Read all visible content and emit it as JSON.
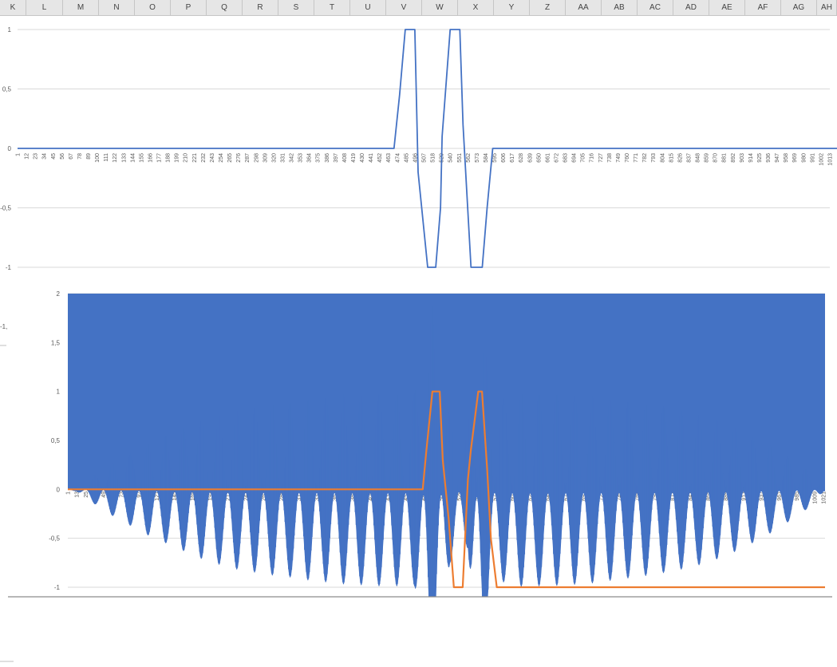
{
  "sheet": {
    "columns": [
      "K",
      "L",
      "M",
      "N",
      "O",
      "P",
      "Q",
      "R",
      "S",
      "T",
      "U",
      "V",
      "W",
      "X",
      "Y",
      "Z",
      "AA",
      "AB",
      "AC",
      "AD",
      "AE",
      "AF",
      "AG",
      "AH"
    ],
    "stray_label": "-1,"
  },
  "colors": {
    "blue_series": "#4472c4",
    "orange_series": "#ed7d31",
    "gridline": "#d9d9d9"
  },
  "chart_data": [
    {
      "type": "line",
      "title": "",
      "xlabel": "",
      "ylabel": "",
      "ylim": [
        -1,
        1
      ],
      "y_ticks": [
        "1",
        "0,5",
        "0",
        "-0,5",
        "-1"
      ],
      "grid": true,
      "x_ticks": [
        "1",
        "12",
        "23",
        "34",
        "45",
        "56",
        "67",
        "78",
        "89",
        "100",
        "111",
        "122",
        "133",
        "144",
        "155",
        "166",
        "177",
        "188",
        "199",
        "210",
        "221",
        "232",
        "243",
        "254",
        "265",
        "276",
        "287",
        "298",
        "309",
        "320",
        "331",
        "342",
        "353",
        "364",
        "375",
        "386",
        "397",
        "408",
        "419",
        "430",
        "441",
        "452",
        "463",
        "474",
        "485",
        "496",
        "507",
        "518",
        "529",
        "540",
        "551",
        "562",
        "573",
        "584",
        "595",
        "606",
        "617",
        "628",
        "639",
        "650",
        "661",
        "672",
        "683",
        "694",
        "705",
        "716",
        "727",
        "738",
        "749",
        "760",
        "771",
        "782",
        "793",
        "804",
        "815",
        "826",
        "837",
        "848",
        "859",
        "870",
        "881",
        "892",
        "903",
        "914",
        "925",
        "936",
        "947",
        "958",
        "969",
        "980",
        "991",
        "1002",
        "1013"
      ],
      "series": [
        {
          "x": [
            1,
            470,
            477,
            484,
            487,
            496,
            500,
            506,
            512,
            518,
            522,
            528,
            530,
            540,
            547,
            552,
            556,
            566,
            573,
            580,
            586,
            593,
            1023
          ],
          "values": [
            0,
            0,
            0.45,
            1,
            1,
            1,
            -0.2,
            -0.6,
            -1,
            -1,
            -1,
            -0.5,
            0.1,
            1,
            1,
            1,
            0.2,
            -1,
            -1,
            -1,
            -0.5,
            0,
            0
          ]
        }
      ]
    },
    {
      "type": "line",
      "title": "",
      "xlabel": "",
      "ylabel": "",
      "ylim": [
        -1,
        2
      ],
      "y_ticks": [
        "2",
        "1,5",
        "1",
        "0,5",
        "0",
        "-0,5",
        "-1"
      ],
      "grid": true,
      "x_ticks": [
        "1",
        "13",
        "25",
        "37",
        "49",
        "61",
        "73",
        "85",
        "97",
        "109",
        "121",
        "133",
        "145",
        "157",
        "169",
        "181",
        "193",
        "205",
        "217",
        "229",
        "241",
        "253",
        "265",
        "277",
        "289",
        "301",
        "313",
        "325",
        "337",
        "349",
        "361",
        "373",
        "385",
        "397",
        "409",
        "421",
        "433",
        "445",
        "457",
        "469",
        "481",
        "493",
        "505",
        "517",
        "529",
        "541",
        "553",
        "565",
        "577",
        "589",
        "601",
        "613",
        "625",
        "637",
        "649",
        "661",
        "673",
        "685",
        "697",
        "709",
        "721",
        "733",
        "745",
        "757",
        "769",
        "781",
        "793",
        "805",
        "817",
        "829",
        "841",
        "853",
        "865",
        "877",
        "889",
        "901",
        "913",
        "925",
        "937",
        "949",
        "961",
        "973",
        "985",
        "997",
        "1009",
        "1021"
      ],
      "series": [
        {
          "description": "high-frequency oscillation with periodic envelope",
          "x_range": [
            1,
            1023
          ],
          "beat_period": 24,
          "envelope_peaks": [
            [
              13,
              0.02
            ],
            [
              37,
              0.15
            ],
            [
              61,
              0.27
            ],
            [
              85,
              0.37
            ],
            [
              109,
              0.47
            ],
            [
              133,
              0.55
            ],
            [
              157,
              0.63
            ],
            [
              181,
              0.71
            ],
            [
              205,
              0.77
            ],
            [
              229,
              0.82
            ],
            [
              253,
              0.85
            ],
            [
              277,
              0.88
            ],
            [
              301,
              0.9
            ],
            [
              325,
              0.93
            ],
            [
              349,
              0.95
            ],
            [
              373,
              0.97
            ],
            [
              397,
              0.98
            ],
            [
              421,
              0.99
            ],
            [
              445,
              0.99
            ],
            [
              469,
              0.99
            ],
            [
              493,
              1.97
            ],
            [
              517,
              0.75
            ],
            [
              541,
              0.6
            ],
            [
              553,
              1.97
            ],
            [
              577,
              0.9
            ],
            [
              601,
              1.0
            ],
            [
              625,
              0.99
            ],
            [
              649,
              0.99
            ],
            [
              673,
              0.98
            ],
            [
              697,
              0.97
            ],
            [
              721,
              0.95
            ],
            [
              745,
              0.92
            ],
            [
              769,
              0.9
            ],
            [
              793,
              0.87
            ],
            [
              817,
              0.84
            ],
            [
              841,
              0.8
            ],
            [
              865,
              0.75
            ],
            [
              889,
              0.68
            ],
            [
              913,
              0.6
            ],
            [
              937,
              0.5
            ],
            [
              961,
              0.4
            ],
            [
              985,
              0.27
            ],
            [
              1009,
              0.15
            ],
            [
              1021,
              0.02
            ]
          ]
        },
        {
          "x": [
            1,
            480,
            485,
            493,
            497,
            503,
            507,
            515,
            522,
            528,
            534,
            541,
            545,
            555,
            560,
            567,
            572,
            580,
            585,
            1023
          ],
          "values": [
            0,
            0,
            0.4,
            1,
            1,
            1,
            0.3,
            -0.3,
            -1,
            -1,
            -1,
            0.1,
            0.4,
            1,
            1,
            0.2,
            -0.5,
            -1,
            -1,
            -1
          ]
        }
      ]
    }
  ]
}
